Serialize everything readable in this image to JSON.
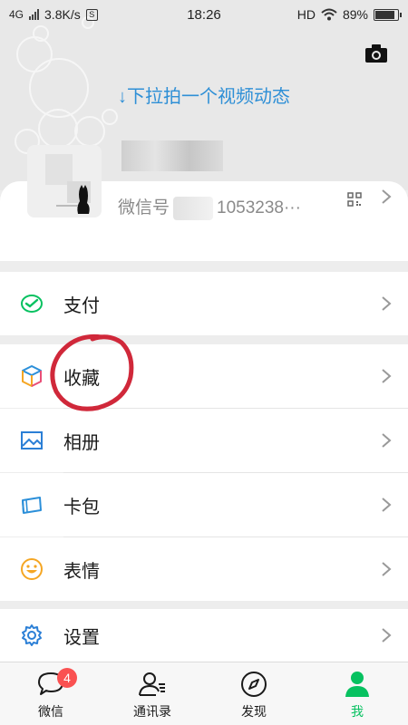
{
  "status_bar": {
    "network": "4G",
    "speed": "3.8K/s",
    "sim_icon_letter": "S",
    "time": "18:26",
    "hd": "HD",
    "battery": "89%",
    "battery_level": 0.89
  },
  "header": {
    "pull_hint": "↓下拉拍一个视频动态",
    "camera_icon": "camera-icon"
  },
  "profile": {
    "wechat_id_prefix": "微信号",
    "wechat_id_suffix": "1053238···",
    "qr_icon": "qr-code-icon",
    "arrow": "chevron-right-icon"
  },
  "menu": {
    "pay": {
      "label": "支付",
      "icon": "pay-icon",
      "color": "#07c160"
    },
    "favorites": {
      "label": "收藏",
      "icon": "favorites-cube-icon"
    },
    "album": {
      "label": "相册",
      "icon": "album-icon",
      "color": "#2b7fd6"
    },
    "cards": {
      "label": "卡包",
      "icon": "card-wallet-icon",
      "color": "#2b8fd9"
    },
    "stickers": {
      "label": "表情",
      "icon": "sticker-face-icon",
      "color": "#f5a623"
    },
    "settings": {
      "label": "设置",
      "icon": "gear-icon",
      "color": "#2b7fd6"
    }
  },
  "annotation_color": "#d0283a",
  "bottom_nav": {
    "chats": {
      "label": "微信",
      "badge": "4",
      "icon": "chat-bubble-icon"
    },
    "contacts": {
      "label": "通讯录",
      "icon": "contacts-icon"
    },
    "discover": {
      "label": "发现",
      "icon": "compass-icon"
    },
    "me": {
      "label": "我",
      "icon": "person-icon",
      "active_color": "#07c160"
    }
  }
}
